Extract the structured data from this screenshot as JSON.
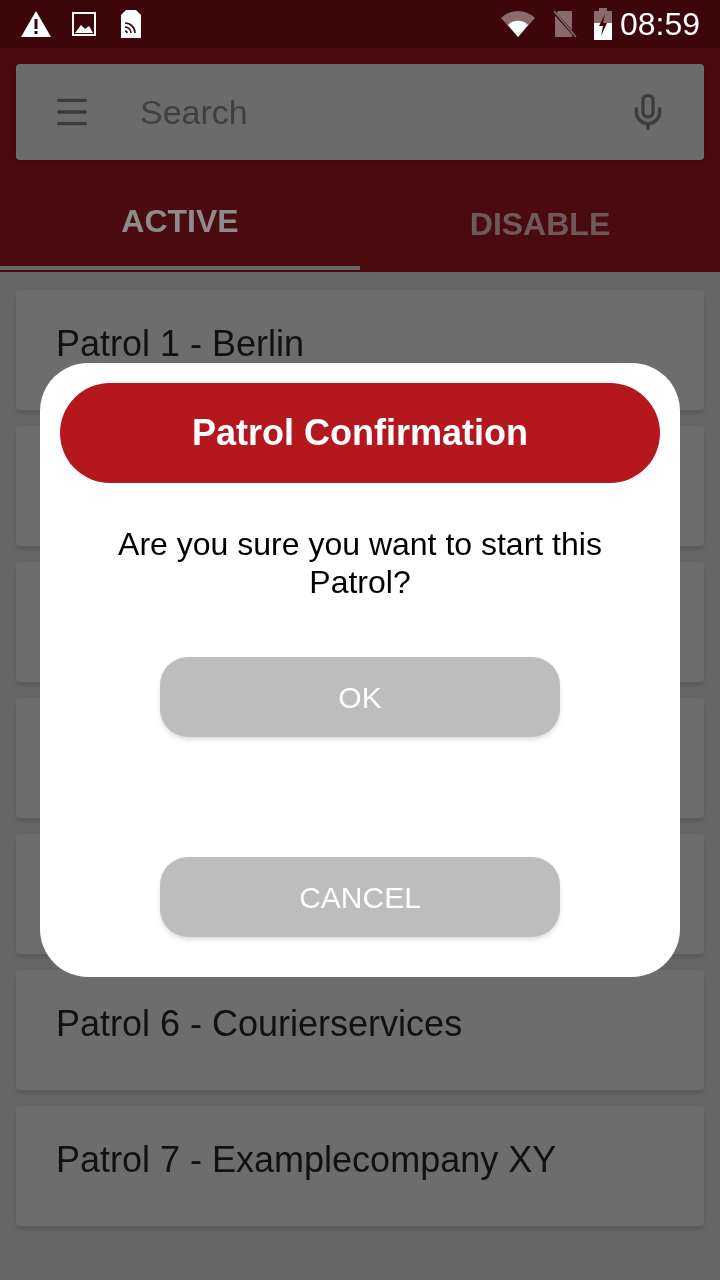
{
  "status_bar": {
    "time": "08:59"
  },
  "search": {
    "placeholder": "Search"
  },
  "tabs": [
    {
      "label": "ACTIVE",
      "selected": true
    },
    {
      "label": "DISABLE",
      "selected": false
    }
  ],
  "patrols": [
    {
      "kind": "text",
      "label": "Patrol 1 - Berlin"
    },
    {
      "kind": "covered"
    },
    {
      "kind": "covered"
    },
    {
      "kind": "covered"
    },
    {
      "kind": "covered"
    },
    {
      "kind": "text",
      "label": "Patrol 6 - Courierservices"
    },
    {
      "kind": "text",
      "label": "Patrol 7 - Examplecompany XY"
    }
  ],
  "dialog": {
    "title": "Patrol Confirmation",
    "message": "Are you sure you want to start this Patrol?",
    "buttons": [
      "OK",
      "CANCEL"
    ]
  }
}
